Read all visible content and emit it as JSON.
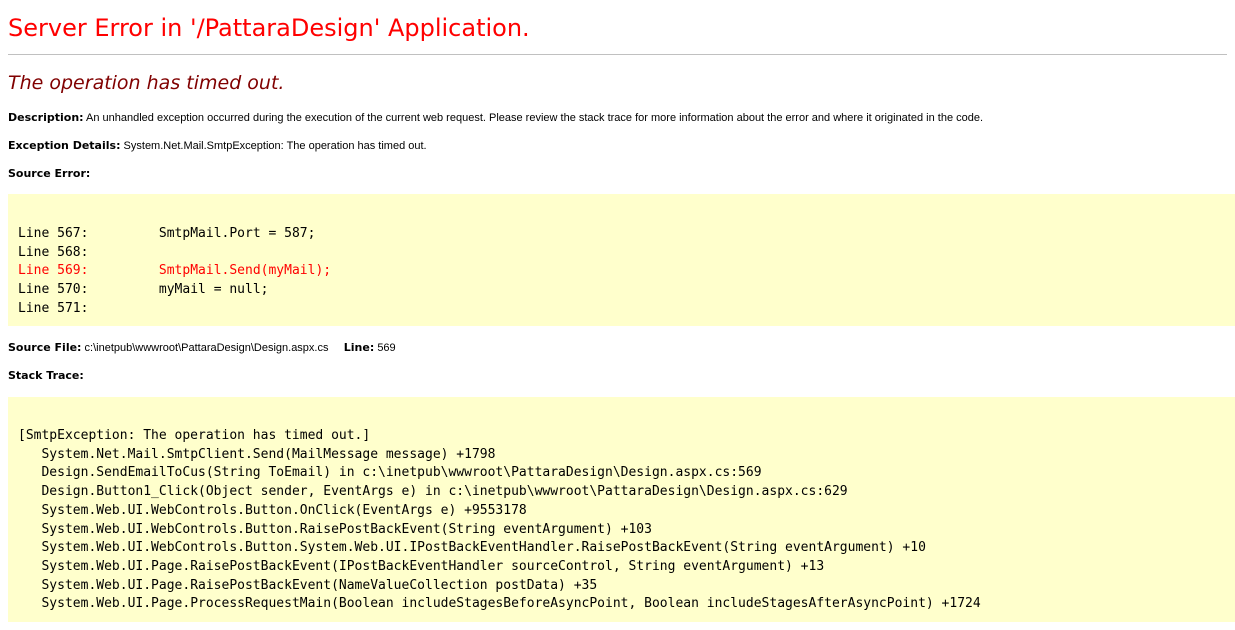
{
  "title": "Server Error in '/PattaraDesign' Application.",
  "message": "The operation has timed out.",
  "description": {
    "label": "Description:",
    "text": "An unhandled exception occurred during the execution of the current web request. Please review the stack trace for more information about the error and where it originated in the code."
  },
  "exception": {
    "label": "Exception Details:",
    "text": "System.Net.Mail.SmtpException: The operation has timed out."
  },
  "source_error": {
    "label": "Source Error:",
    "lines": [
      {
        "num": "Line 567:",
        "code": "SmtpMail.Port = 587;"
      },
      {
        "num": "Line 568:",
        "code": ""
      },
      {
        "num": "Line 569:",
        "code": "SmtpMail.Send(myMail);"
      },
      {
        "num": "Line 570:",
        "code": "myMail = null;"
      },
      {
        "num": "Line 571:",
        "code": ""
      }
    ]
  },
  "source_file": {
    "label": "Source File:",
    "path": "c:\\inetpub\\wwwroot\\PattaraDesign\\Design.aspx.cs",
    "line_label": "Line:",
    "line_value": "569"
  },
  "stack_trace": {
    "label": "Stack Trace:",
    "header": "[SmtpException: The operation has timed out.]",
    "frames": [
      "System.Net.Mail.SmtpClient.Send(MailMessage message) +1798",
      "Design.SendEmailToCus(String ToEmail) in c:\\inetpub\\wwwroot\\PattaraDesign\\Design.aspx.cs:569",
      "Design.Button1_Click(Object sender, EventArgs e) in c:\\inetpub\\wwwroot\\PattaraDesign\\Design.aspx.cs:629",
      "System.Web.UI.WebControls.Button.OnClick(EventArgs e) +9553178",
      "System.Web.UI.WebControls.Button.RaisePostBackEvent(String eventArgument) +103",
      "System.Web.UI.WebControls.Button.System.Web.UI.IPostBackEventHandler.RaisePostBackEvent(String eventArgument) +10",
      "System.Web.UI.Page.RaisePostBackEvent(IPostBackEventHandler sourceControl, String eventArgument) +13",
      "System.Web.UI.Page.RaisePostBackEvent(NameValueCollection postData) +35",
      "System.Web.UI.Page.ProcessRequestMain(Boolean includeStagesBeforeAsyncPoint, Boolean includeStagesAfterAsyncPoint) +1724"
    ]
  },
  "colors": {
    "title": "#ff0000",
    "message": "#800000",
    "highlight_line": "#ff0000",
    "box_background": "#ffffcc"
  }
}
